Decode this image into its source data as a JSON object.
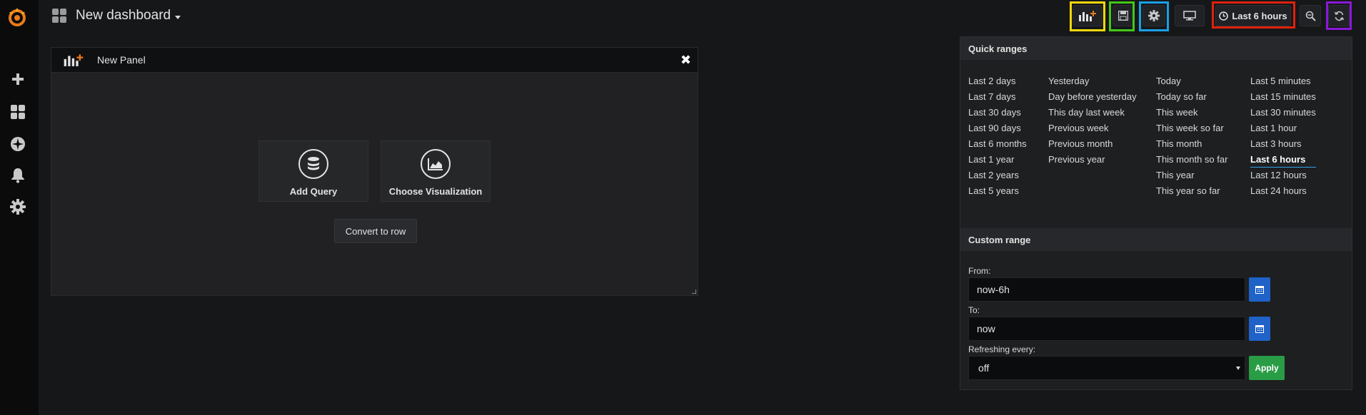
{
  "app": {
    "name": "Grafana"
  },
  "header": {
    "dashboard_title": "New dashboard",
    "time_range_label": "Last 6 hours"
  },
  "icons": {
    "logo": "grafana-logo",
    "add_panel": "add-panel-icon",
    "save": "save-icon",
    "settings": "gear-icon",
    "tv_mode": "monitor-icon",
    "time": "clock-icon",
    "zoom_out": "zoom-out-icon",
    "refresh": "refresh-icon"
  },
  "colors": {
    "brand": "#eb7b18",
    "highlight_yellow": "#f5d90c",
    "highlight_green": "#43c816",
    "highlight_blue": "#1aa0e8",
    "highlight_red": "#e0210c",
    "highlight_purple": "#8a18d8",
    "calendar_button": "#1f62c8",
    "apply_button": "#299c46",
    "active_underline": "#33a2e5"
  },
  "panel": {
    "title": "New Panel",
    "add_query_label": "Add Query",
    "choose_visualization_label": "Choose Visualization",
    "convert_to_row_label": "Convert to row"
  },
  "time_picker": {
    "quick_ranges_title": "Quick ranges",
    "columns": [
      [
        "Last 2 days",
        "Last 7 days",
        "Last 30 days",
        "Last 90 days",
        "Last 6 months",
        "Last 1 year",
        "Last 2 years",
        "Last 5 years"
      ],
      [
        "Yesterday",
        "Day before yesterday",
        "This day last week",
        "Previous week",
        "Previous month",
        "Previous year"
      ],
      [
        "Today",
        "Today so far",
        "This week",
        "This week so far",
        "This month",
        "This month so far",
        "This year",
        "This year so far"
      ],
      [
        "Last 5 minutes",
        "Last 15 minutes",
        "Last 30 minutes",
        "Last 1 hour",
        "Last 3 hours",
        "Last 6 hours",
        "Last 12 hours",
        "Last 24 hours"
      ]
    ],
    "active_range": "Last 6 hours",
    "custom_range_title": "Custom range",
    "from_label": "From:",
    "from_value": "now-6h",
    "to_label": "To:",
    "to_value": "now",
    "refresh_label": "Refreshing every:",
    "refresh_value": "off",
    "apply_label": "Apply"
  }
}
